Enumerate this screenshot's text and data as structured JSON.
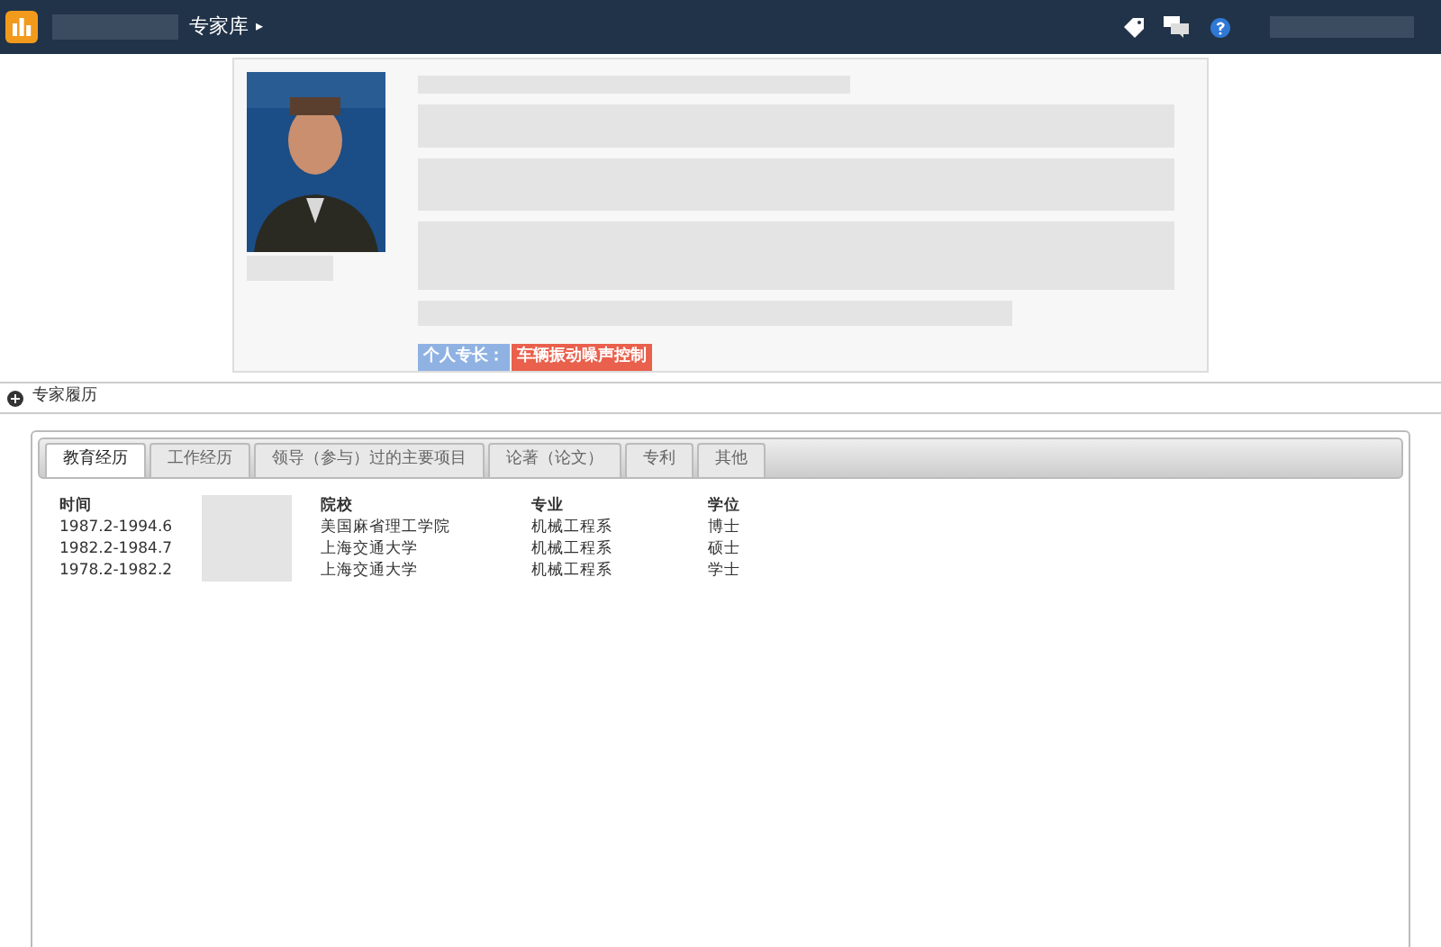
{
  "top_bar": {
    "breadcrumb": "专家库",
    "separator": "▸"
  },
  "profile": {
    "specialty_label": "个人专长：",
    "specialty": "车辆振动噪声控制"
  },
  "section": {
    "title": "专家履历",
    "expanded": false
  },
  "tabs": [
    {
      "label": "教育经历",
      "selected": true
    },
    {
      "label": "工作经历",
      "selected": false
    },
    {
      "label": "领导（参与）过的主要项目",
      "selected": false
    },
    {
      "label": "论著（论文）",
      "selected": false
    },
    {
      "label": "专利",
      "selected": false
    },
    {
      "label": "其他",
      "selected": false
    }
  ],
  "table": {
    "columns": [
      "时间",
      "院校",
      "专业",
      "学位"
    ],
    "rows": [
      [
        "1987.2-1994.6",
        "美国麻省理工学院",
        "机械工程系",
        "博士"
      ],
      [
        "1982.2-1984.7",
        "上海交通大学",
        "机械工程系",
        "硕士"
      ],
      [
        "1978.2-1982.2",
        "上海交通大学",
        "机械工程系",
        "学士"
      ]
    ]
  }
}
